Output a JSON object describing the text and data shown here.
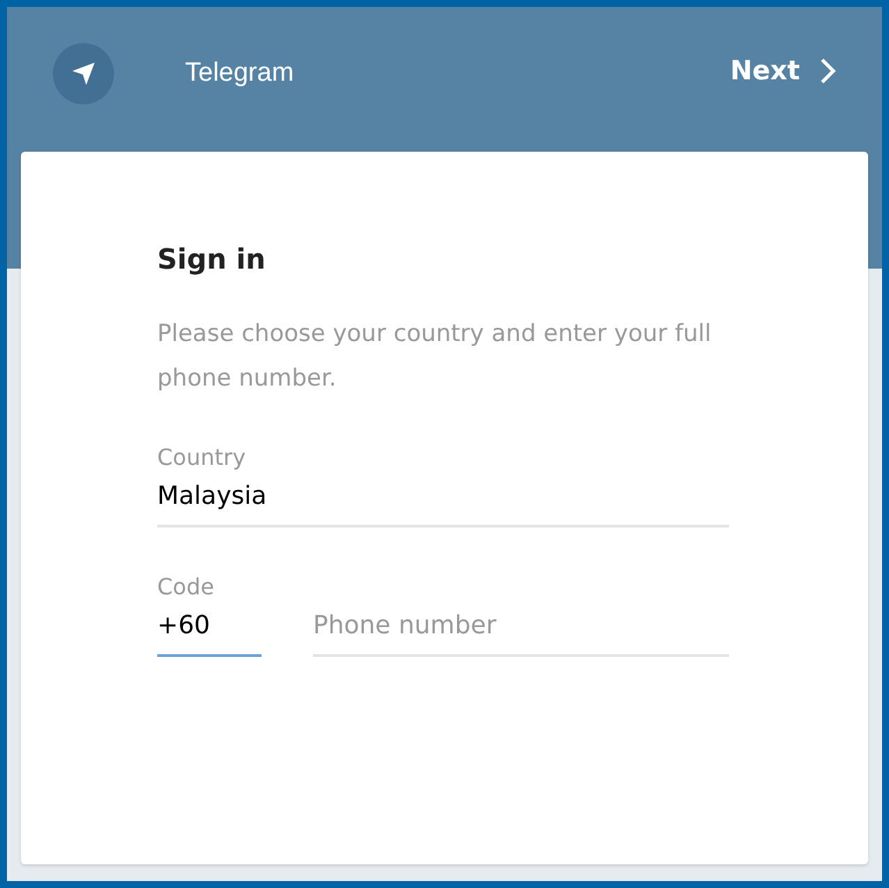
{
  "header": {
    "title": "Telegram",
    "next_button": "Next"
  },
  "card": {
    "heading": "Sign in",
    "description": "Please choose your country and enter your full phone number.",
    "country": {
      "label": "Country",
      "value": "Malaysia",
      "focused": false
    },
    "code": {
      "label": "Code",
      "value": "+60",
      "focused": true
    },
    "phone": {
      "placeholder": "Phone number",
      "focused": false
    }
  }
}
